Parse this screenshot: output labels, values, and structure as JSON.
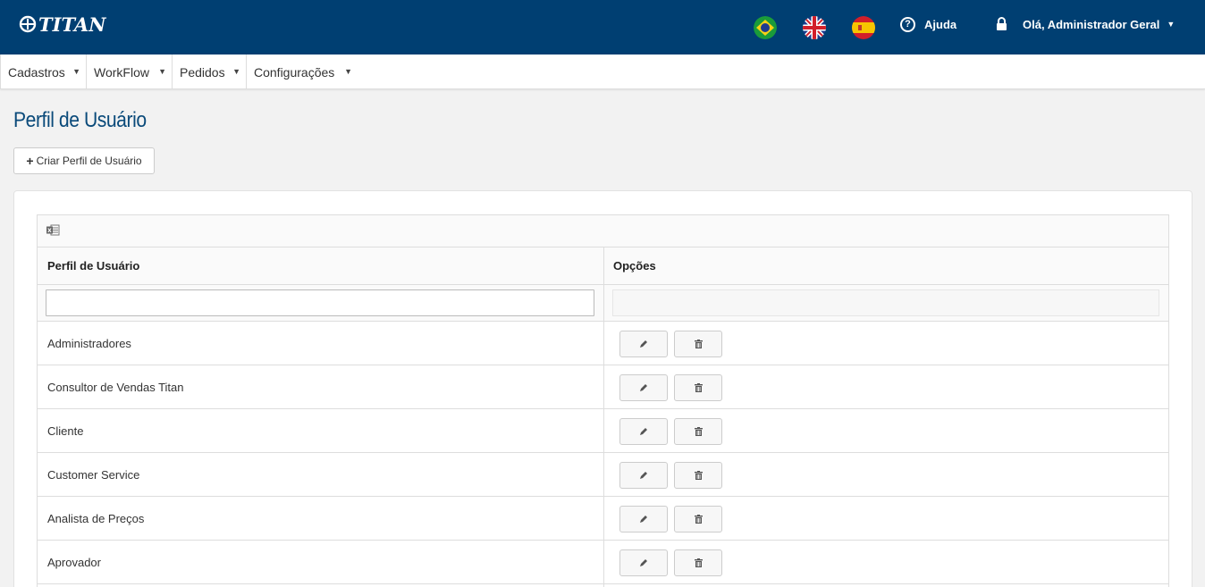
{
  "header": {
    "logo_text": "TITAN",
    "flags": [
      "brazil-flag",
      "uk-flag",
      "spain-flag"
    ],
    "help_label": "Ajuda",
    "user_label": "Olá, Administrador Geral",
    "brand_color": "#003f72"
  },
  "menu": {
    "items": [
      {
        "label": "Cadastros"
      },
      {
        "label": "WorkFlow"
      },
      {
        "label": "Pedidos"
      },
      {
        "label": "Configurações"
      }
    ]
  },
  "page": {
    "title": "Perfil de Usuário",
    "create_button": "Criar Perfil de Usuário"
  },
  "table": {
    "columns": [
      "Perfil de Usuário",
      "Opções"
    ],
    "filter_value": "",
    "rows": [
      {
        "name": "Administradores"
      },
      {
        "name": "Consultor de Vendas Titan"
      },
      {
        "name": "Cliente"
      },
      {
        "name": "Customer Service"
      },
      {
        "name": "Analista de Preços"
      },
      {
        "name": "Aprovador"
      }
    ]
  }
}
